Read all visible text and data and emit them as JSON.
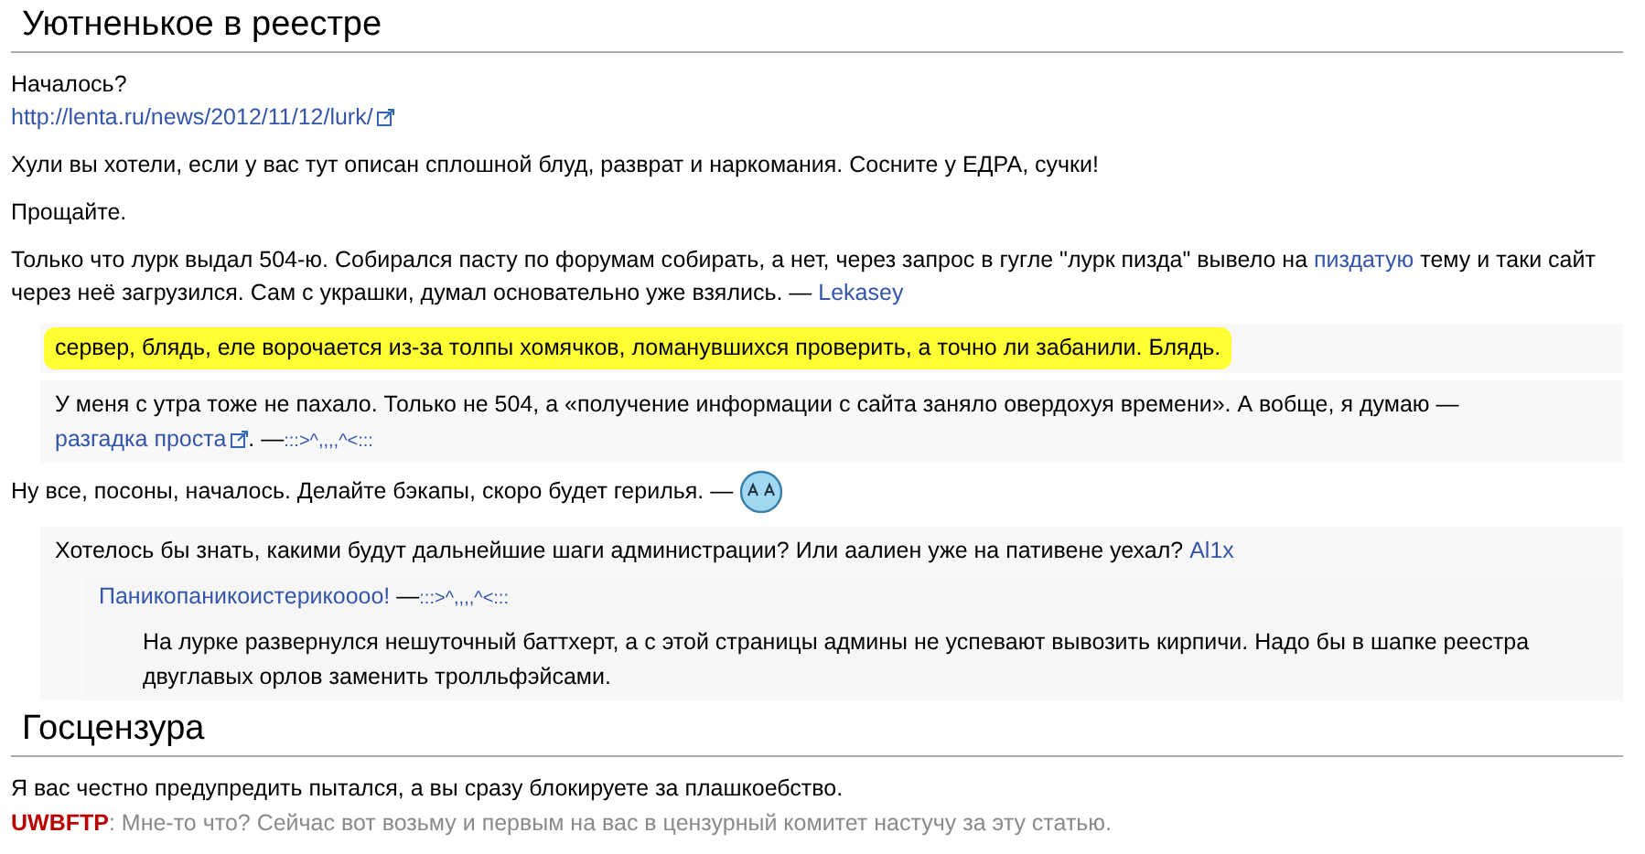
{
  "sections": [
    {
      "title": "Уютненькое в реестре",
      "blocks": [
        {
          "kind": "paragraph",
          "parts": [
            {
              "kind": "text",
              "text": "Началось?"
            },
            {
              "kind": "break"
            },
            {
              "kind": "external",
              "text": "http://lenta.ru/news/2012/11/12/lurk/"
            }
          ]
        },
        {
          "kind": "paragraph",
          "parts": [
            {
              "kind": "text",
              "text": "Хули вы хотели, если у вас тут описан сплошной блуд, разврат и наркомания. Сосните у ЕДРА, сучки!"
            }
          ]
        },
        {
          "kind": "paragraph",
          "parts": [
            {
              "kind": "text",
              "text": "Прощайте."
            }
          ]
        },
        {
          "kind": "paragraph",
          "parts": [
            {
              "kind": "text",
              "text": "Только что лурк выдал 504-ю. Собирался пасту по форумам собирать, а нет, через запрос в гугле \"лурк пизда\" вывело на "
            },
            {
              "kind": "link",
              "text": "пиздатую"
            },
            {
              "kind": "text",
              "text": " тему и таки сайт через неё загрузился. Сам с украшки, думал основательно уже взялись. — "
            },
            {
              "kind": "link",
              "text": "Lekasey"
            }
          ]
        },
        {
          "kind": "comment",
          "highlighted": true,
          "parts": [
            {
              "kind": "text",
              "text": "сервер, блядь, еле ворочается из-за толпы хомячков, ломанувшихся проверить, а точно ли забанили. Блядь."
            }
          ]
        },
        {
          "kind": "comment",
          "highlighted": false,
          "parts": [
            {
              "kind": "text",
              "text": "У меня с утра тоже не пахало. Только не 504, а «получение информации с сайта заняло овердохуя времени». А вобще, я думаю — "
            },
            {
              "kind": "external",
              "text": "разгадка проста"
            },
            {
              "kind": "text",
              "text": ". —"
            },
            {
              "kind": "signature",
              "text": ":::>^,,,,^<:::"
            }
          ]
        },
        {
          "kind": "paragraph",
          "parts": [
            {
              "kind": "text",
              "text": "Ну все, посоны, началось. Делайте бэкапы, скоро будет герилья. — "
            },
            {
              "kind": "smiley"
            }
          ]
        },
        {
          "kind": "comment",
          "highlighted": false,
          "parts": [
            {
              "kind": "text",
              "text": "Хотелось бы знать, какими будут дальнейшие шаги администрации? Или аалиен уже на пативене уехал? "
            },
            {
              "kind": "link",
              "text": "Al1x"
            }
          ],
          "children": [
            {
              "kind": "comment",
              "highlighted": false,
              "parts": [
                {
                  "kind": "link",
                  "text": "Паникопаникоистерикоооо!"
                },
                {
                  "kind": "text",
                  "text": " —"
                },
                {
                  "kind": "signature",
                  "text": ":::>^,,,,^<:::"
                }
              ],
              "children": [
                {
                  "kind": "comment",
                  "highlighted": false,
                  "parts": [
                    {
                      "kind": "text",
                      "text": "На лурке развернулся нешуточный баттхерт, а с этой страницы админы не успевают вывозить кирпичи. Надо бы в шапке реестра двуглавых орлов заменить тролльфэйсами."
                    }
                  ]
                }
              ]
            }
          ]
        }
      ]
    },
    {
      "title": "Госцензура",
      "blocks": [
        {
          "kind": "paragraph",
          "parts": [
            {
              "kind": "text",
              "text": "Я вас честно предупредить пытался, а вы сразу блокируете за плашкоебство."
            },
            {
              "kind": "break"
            },
            {
              "kind": "redlink",
              "text": "UWBFTP"
            },
            {
              "kind": "muted",
              "text": ": Мне-то что? Сейчас вот возьму и первым на вас в цензурный комитет настучу за эту статью."
            }
          ]
        }
      ]
    }
  ]
}
